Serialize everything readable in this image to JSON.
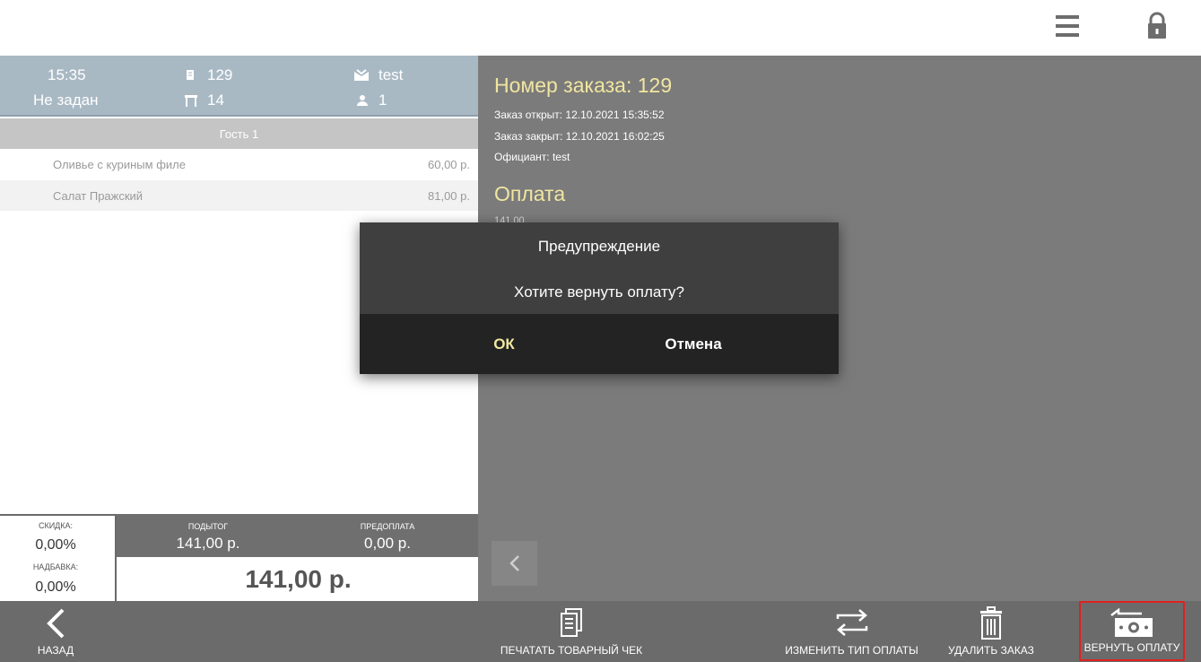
{
  "header": {
    "menu_icon": "hamburger-menu-icon",
    "lock_icon": "lock-icon"
  },
  "order_info": {
    "time": "15:35",
    "order_number": "129",
    "waiter": "test",
    "table_status": "Не задан",
    "table_number": "14",
    "guests": "1"
  },
  "guest_bar": {
    "label": "Гость 1"
  },
  "items": [
    {
      "name": "Оливье с куриным филе",
      "price": "60,00 р."
    },
    {
      "name": "Салат Пражский",
      "price": "81,00 р."
    }
  ],
  "totals": {
    "discount_label": "СКИДКА:",
    "discount_value": "0,00%",
    "markup_label": "НАДБАВКА:",
    "markup_value": "0,00%",
    "subtotal_label": "ПОДЫТОГ",
    "subtotal_value": "141,00 р.",
    "prepayment_label": "ПРЕДОПЛАТА",
    "prepayment_value": "0,00 р.",
    "total": "141,00 р."
  },
  "details": {
    "order_title": "Номер заказа: 129",
    "opened": "Заказ открыт: 12.10.2021 15:35:52",
    "closed": "Заказ закрыт: 12.10.2021 16:02:25",
    "waiter": "Официант: test",
    "payment_title": "Оплата",
    "payment_partial": "141,00"
  },
  "dialog": {
    "title": "Предупреждение",
    "message": "Хотите вернуть оплату?",
    "ok_label": "ОК",
    "cancel_label": "Отмена"
  },
  "bottom_bar": {
    "back": "НАЗАД",
    "print_receipt": "ПЕЧАТАТЬ ТОВАРНЫЙ ЧЕК",
    "change_payment_type": "ИЗМЕНИТЬ ТИП ОПЛАТЫ",
    "delete_order": "УДАЛИТЬ ЗАКАЗ",
    "refund_payment": "ВЕРНУТЬ ОПЛАТУ"
  },
  "colors": {
    "accent_title": "#f1e6a0",
    "dialog_ok": "#f1e6a0",
    "highlight_border": "#e02020"
  }
}
